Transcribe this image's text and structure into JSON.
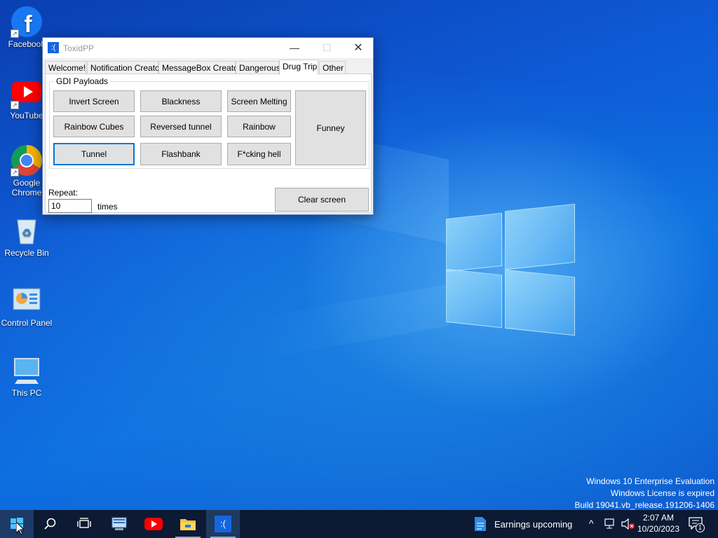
{
  "desktop": {
    "icons": [
      {
        "label": "Facebook",
        "icon": "facebook-icon"
      },
      {
        "label": "YouTube",
        "icon": "youtube-icon"
      },
      {
        "label": "Google Chrome",
        "icon": "chrome-icon"
      },
      {
        "label": "Recycle Bin",
        "icon": "recycle-bin-icon"
      },
      {
        "label": "Control Panel",
        "icon": "control-panel-icon"
      },
      {
        "label": "This PC",
        "icon": "this-pc-icon"
      }
    ],
    "watermark": {
      "line1": "Windows 10 Enterprise Evaluation",
      "line2": "Windows License is expired",
      "line3": "Build 19041.vb_release.191206-1406"
    }
  },
  "window": {
    "title": "ToxidPP",
    "icon_glyph": ":(",
    "minimize": "—",
    "maximize": "☐",
    "close": "✕",
    "tabs": [
      {
        "label": "Welcome!"
      },
      {
        "label": "Notification Creator"
      },
      {
        "label": "MessageBox Creator"
      },
      {
        "label": "Dangerous"
      },
      {
        "label": "Drug Trip",
        "active": true
      },
      {
        "label": "Other"
      }
    ],
    "group_title": "GDI Payloads",
    "buttons": {
      "invert_screen": "Invert Screen",
      "blackness": "Blackness",
      "screen_melting": "Screen Melting",
      "funney": "Funney",
      "rainbow_cubes": "Rainbow Cubes",
      "reversed_tunnel": "Reversed tunnel",
      "rainbow": "Rainbow",
      "tunnel": "Tunnel",
      "flashbank": "Flashbank",
      "fcking_hell": "F*cking hell",
      "clear_screen": "Clear screen"
    },
    "repeat_label": "Repeat:",
    "repeat_value": "10",
    "times_label": "times"
  },
  "taskbar": {
    "items": [
      "start-icon",
      "search-icon",
      "task-view-icon",
      "network-app-icon",
      "youtube-icon",
      "file-explorer-icon",
      "toxidpp-icon"
    ],
    "toxidpp_glyph": ":(",
    "news_text": "Earnings upcoming",
    "time": "2:07 AM",
    "date": "10/20/2023",
    "notification_count": "1",
    "colors": {
      "taskbar": "#0c1a33",
      "accent": "#0078d7"
    }
  }
}
